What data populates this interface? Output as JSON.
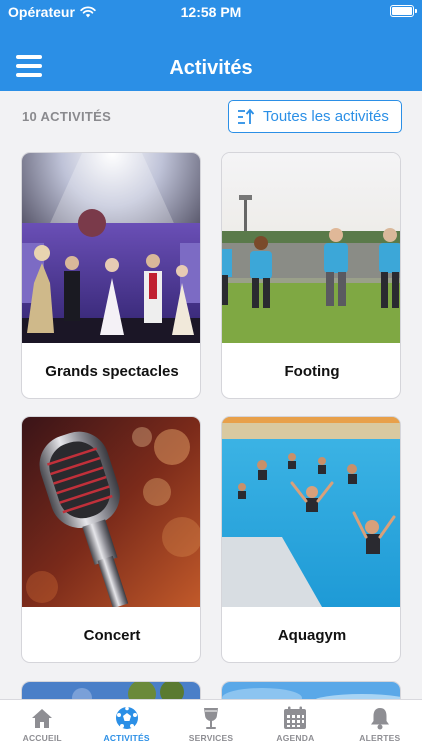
{
  "status": {
    "carrier": "Opérateur",
    "time": "12:58 PM"
  },
  "header": {
    "title": "Activités"
  },
  "toolbar": {
    "count": "10 ACTIVITÉS",
    "filter_label": "Toutes les activités"
  },
  "activities": [
    {
      "label": "Grands spectacles"
    },
    {
      "label": "Footing"
    },
    {
      "label": "Concert"
    },
    {
      "label": "Aquagym"
    }
  ],
  "tabs": [
    {
      "label": "ACCUEIL",
      "icon": "home-icon"
    },
    {
      "label": "ACTIVITÉS",
      "icon": "soccer-ball-icon"
    },
    {
      "label": "SERVICES",
      "icon": "wine-glass-icon"
    },
    {
      "label": "AGENDA",
      "icon": "calendar-icon"
    },
    {
      "label": "ALERTES",
      "icon": "bell-icon"
    }
  ],
  "colors": {
    "accent": "#2b8fe6",
    "inactive": "#8e8e93",
    "background": "#f2f2f4"
  }
}
